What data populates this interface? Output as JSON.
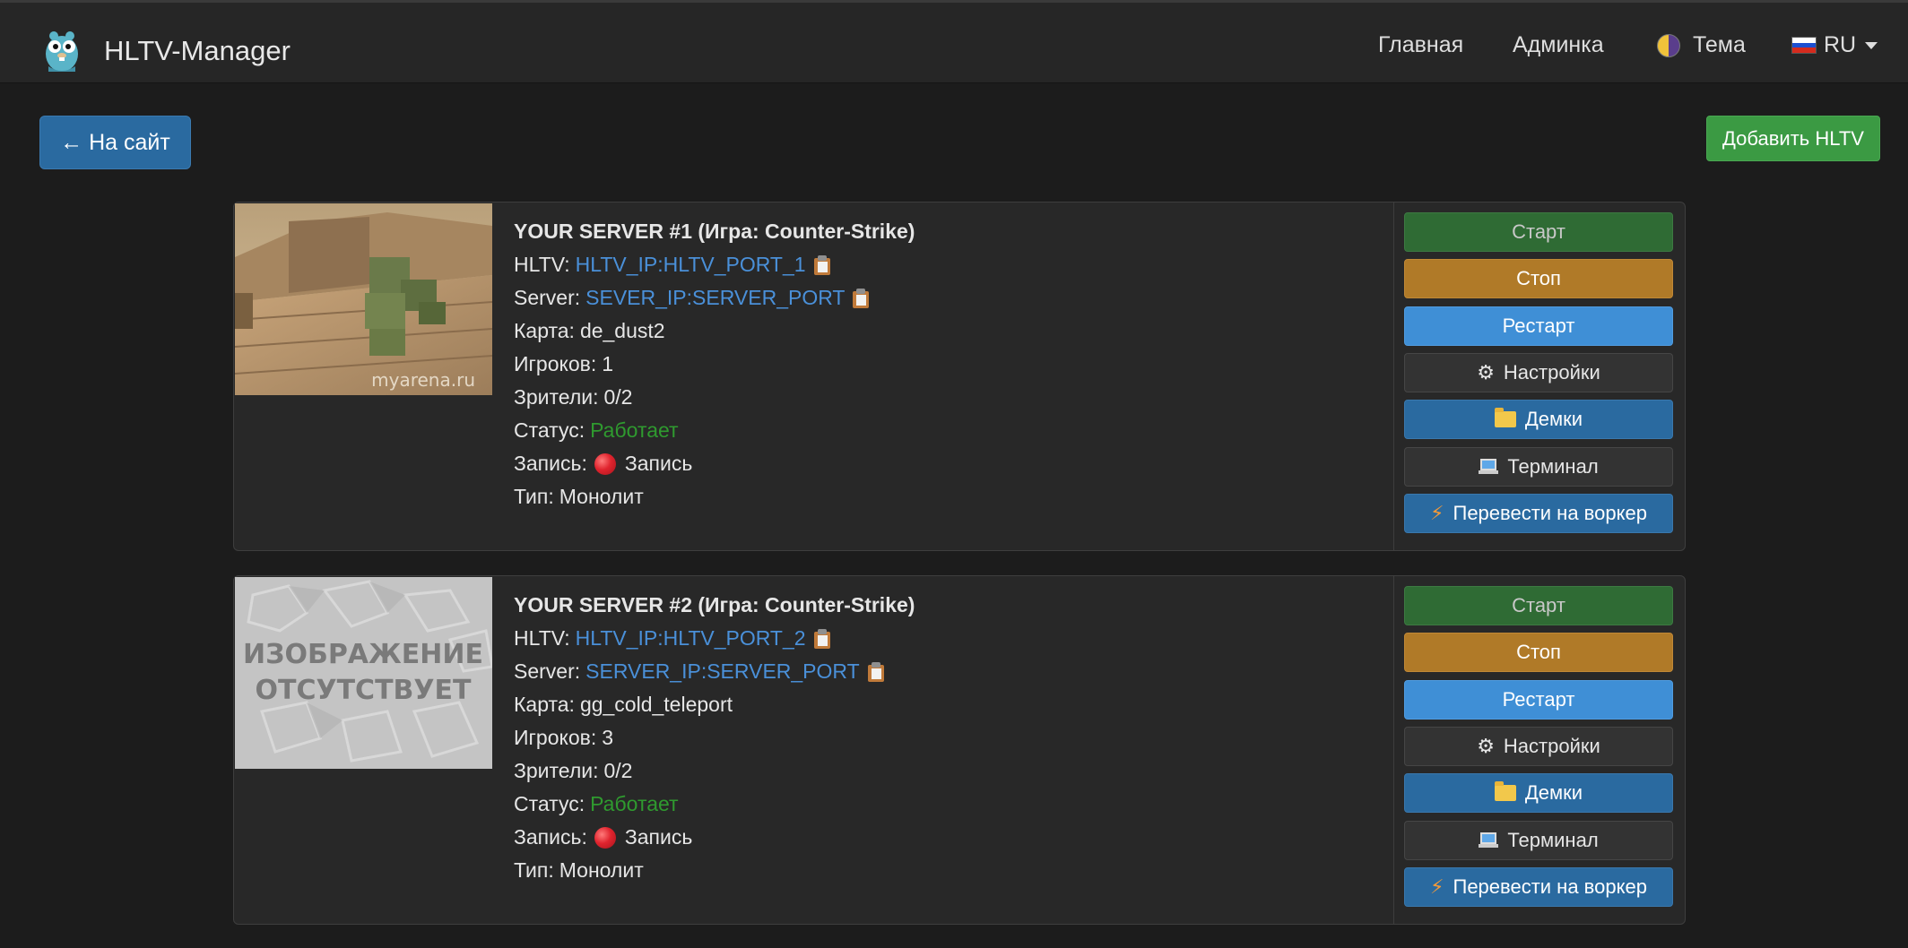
{
  "navbar": {
    "brand": "HLTV-Manager",
    "home": "Главная",
    "admin": "Админка",
    "theme": "Тема",
    "lang": "RU"
  },
  "toolbar": {
    "back_label": "← На сайт",
    "add_label": "Добавить HLTV"
  },
  "labels": {
    "hltv": "HLTV:",
    "server": "Server:",
    "map": "Карта:",
    "players": "Игроков:",
    "viewers": "Зрители:",
    "status": "Статус:",
    "record": "Запись:",
    "type": "Тип:"
  },
  "actions": {
    "start": "Старт",
    "stop": "Стоп",
    "restart": "Рестарт",
    "settings": "Настройки",
    "demos": "Демки",
    "terminal": "Терминал",
    "worker": "Перевести на воркер"
  },
  "servers": [
    {
      "title": "YOUR SERVER #1 (Игра: Counter-Strike)",
      "hltv": "HLTV_IP:HLTV_PORT_1",
      "server": "SEVER_IP:SERVER_PORT",
      "map": "de_dust2",
      "players": "1",
      "viewers": "0/2",
      "status": "Работает",
      "record": "Запись",
      "type": "Монолит",
      "thumb_watermark": "myarena.ru"
    },
    {
      "title": "YOUR SERVER #2 (Игра: Counter-Strike)",
      "hltv": "HLTV_IP:HLTV_PORT_2",
      "server": "SERVER_IP:SERVER_PORT",
      "map": "gg_cold_teleport",
      "players": "3",
      "viewers": "0/2",
      "status": "Работает",
      "record": "Запись",
      "type": "Монолит",
      "thumb_text_1": "ИЗОБРАЖЕНИЕ",
      "thumb_text_2": "ОТСУТСТВУЕТ"
    }
  ],
  "colors": {
    "background": "#1c1c1c",
    "navbar": "#262626",
    "link": "#4a90d9",
    "status_ok": "#2f9a2f",
    "start": "#2f6b34",
    "stop": "#b07a28",
    "restart": "#3f8fd6",
    "primary": "#2a6aa0",
    "add": "#3b9a43"
  },
  "icons": {
    "logo": "gopher-logo",
    "theme": "half-moon-icon",
    "lang": "russia-flag-icon",
    "copy": "clipboard-icon",
    "record": "red-circle-icon",
    "settings": "gear-icon",
    "demos": "folder-icon",
    "terminal": "laptop-icon",
    "worker": "lightning-icon"
  }
}
